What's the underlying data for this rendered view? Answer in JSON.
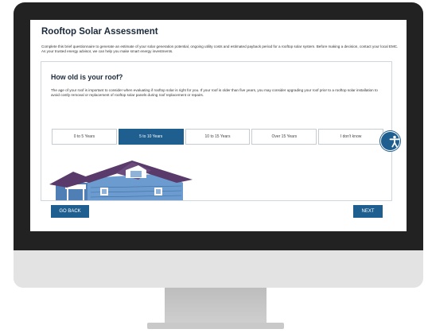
{
  "app": {
    "title": "Rooftop Solar Assessment",
    "intro": "Complete this brief questionnaire to generate an estimate of your solar generation potential, ongoing utility costs and estimated payback period for a rooftop solar system. Before making a decision, contact your local EMC. As your trusted energy advisor, we can help you make smart energy investments."
  },
  "question": {
    "title": "How old is your roof?",
    "help": "The age of your roof is important to consider when evaluating if rooftop solar is right for you. If your roof is older than five years, you may consider upgrading your roof prior to a rooftop solar installation to avoid costly removal or replacement of rooftop solar panels during roof replacement or repairs.",
    "options": [
      {
        "label": "0 to 5 Years",
        "selected": false
      },
      {
        "label": "5 to 10 Years",
        "selected": true
      },
      {
        "label": "10 to 15 Years",
        "selected": false
      },
      {
        "label": "Over 15 Years",
        "selected": false
      },
      {
        "label": "I don't know",
        "selected": false
      }
    ]
  },
  "nav": {
    "back_label": "GO BACK",
    "next_label": "NEXT"
  },
  "icons": {
    "accessibility": "accessibility-icon",
    "house": "house-illustration"
  },
  "colors": {
    "accent": "#1f5f8f",
    "title_text": "#1a2a3a",
    "roof": "#5a3a6a",
    "siding": "#4f7fb5"
  }
}
